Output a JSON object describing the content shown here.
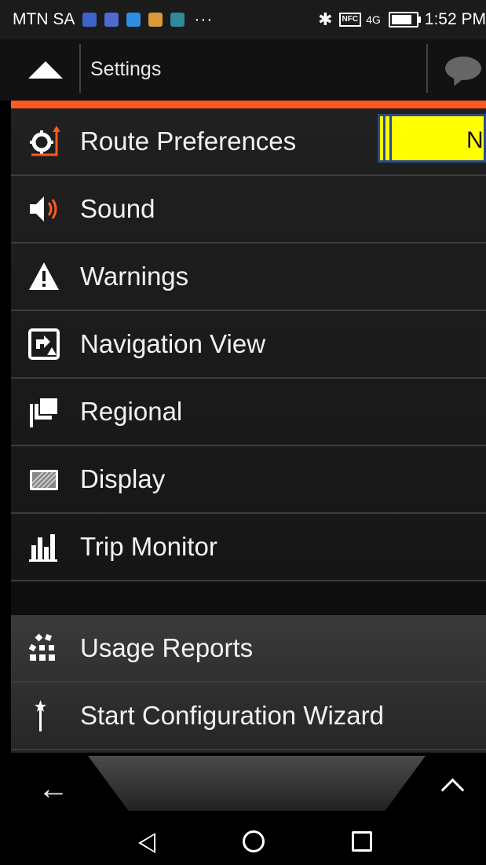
{
  "status_bar": {
    "carrier": "MTN SA",
    "overflow": "···",
    "bluetooth": "✱",
    "nfc": "NFC",
    "signal": "4G",
    "time": "1:52 PM",
    "notification_icons": [
      "maps-icon",
      "opera-icon",
      "messenger-icon",
      "shop-icon",
      "gallery-icon"
    ]
  },
  "header": {
    "title": "Settings"
  },
  "colors": {
    "accent": "#ff5a1f",
    "highlight": "#ffff00",
    "highlight_border": "#2a4b8a"
  },
  "menu": {
    "items": [
      {
        "label": "Route Preferences",
        "icon": "route-preferences-icon"
      },
      {
        "label": "Sound",
        "icon": "sound-icon"
      },
      {
        "label": "Warnings",
        "icon": "warning-icon"
      },
      {
        "label": "Navigation View",
        "icon": "navigation-view-icon"
      },
      {
        "label": "Regional",
        "icon": "regional-flag-icon"
      },
      {
        "label": "Display",
        "icon": "display-icon"
      },
      {
        "label": "Trip Monitor",
        "icon": "trip-monitor-icon"
      }
    ],
    "secondary": [
      {
        "label": "Usage Reports",
        "icon": "usage-reports-icon"
      },
      {
        "label": "Start Configuration Wizard",
        "icon": "wizard-wand-icon"
      }
    ]
  },
  "overlay": {
    "text": "N"
  },
  "bottom_nav": {
    "back": "←"
  }
}
